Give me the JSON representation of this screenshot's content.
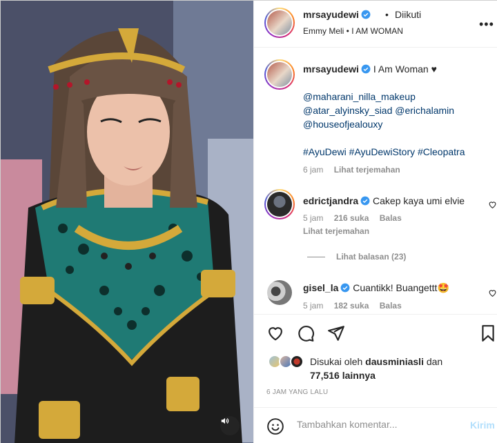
{
  "header": {
    "username": "mrsayudewi",
    "follow_status": "Diikuti",
    "audio": "Emmy Meli • I AM WOMAN",
    "more": "•••"
  },
  "caption": {
    "username": "mrsayudewi",
    "text": "I Am Woman ♥",
    "mentions": [
      "@maharani_nilla_makeup",
      "@atar_alyinsky_siad @erichalamin",
      "@houseofjealouxy"
    ],
    "hashtags": "#AyuDewi #AyuDewiStory #Cleopatra",
    "time": "6 jam",
    "translate": "Lihat terjemahan"
  },
  "comments": [
    {
      "username": "edrictjandra",
      "text": "Cakep kaya umi elvie",
      "time": "5 jam",
      "likes": "216 suka",
      "reply": "Balas",
      "translate": "Lihat terjemahan",
      "view_replies": "Lihat balasan (23)"
    },
    {
      "username": "gisel_la",
      "text": "Cuantikk! Buangettt🤩",
      "time": "5 jam",
      "likes": "182 suka",
      "reply": "Balas"
    }
  ],
  "likes": {
    "prefix": "Disukai oleh",
    "user": "dausminiasli",
    "conj": "dan",
    "count": "77,516 lainnya"
  },
  "timestamp": "6 JAM YANG LALU",
  "comment_box": {
    "placeholder": "Tambahkan komentar...",
    "post_label": "Kirim"
  },
  "colors": {
    "accent_link": "#00376b",
    "verified": "#3897f0",
    "post_button": "#b2dffc",
    "muted_text": "#8e8e8e"
  },
  "icons": [
    "heart-icon",
    "comment-icon",
    "share-icon",
    "bookmark-icon",
    "emoji-icon",
    "volume-icon",
    "verified-icon"
  ]
}
